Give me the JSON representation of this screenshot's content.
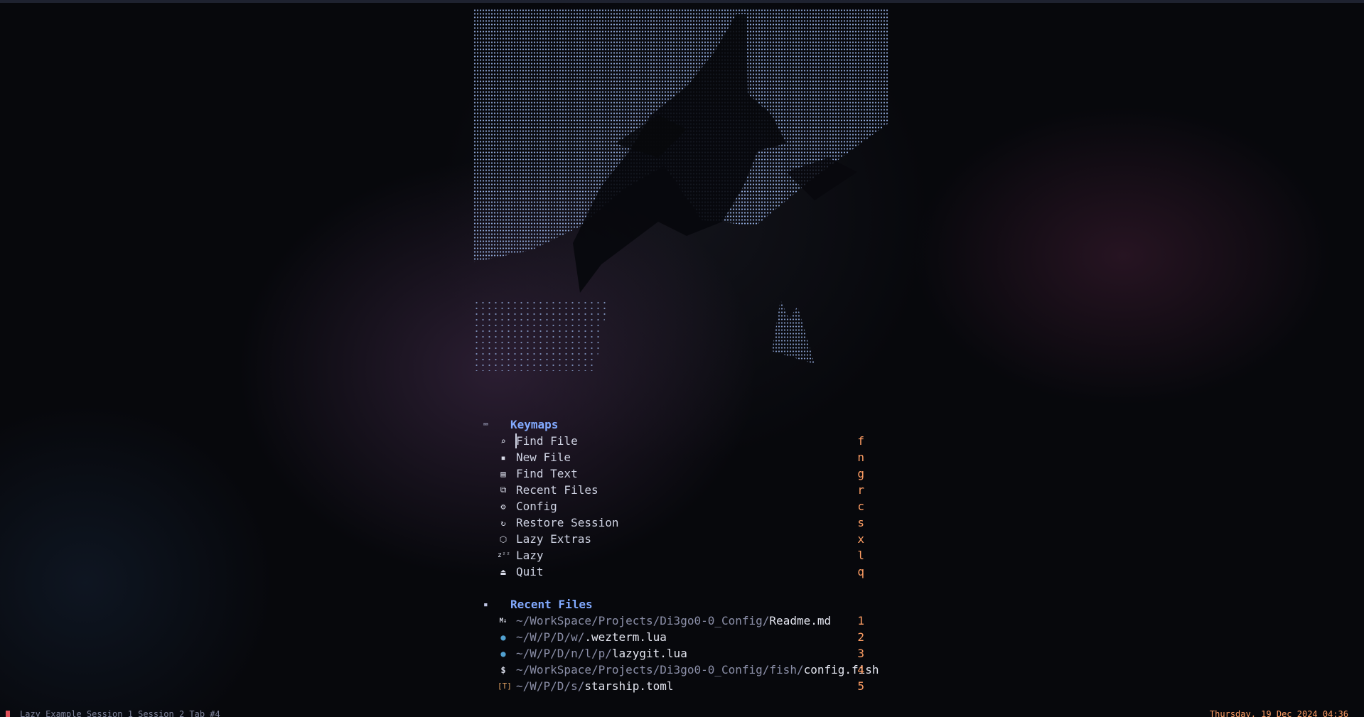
{
  "keymaps": {
    "title": "Keymaps",
    "items": [
      {
        "icon": "search-icon",
        "glyph": "⌕",
        "label": "Find File",
        "key": "f"
      },
      {
        "icon": "file-icon",
        "glyph": "▪",
        "label": "New File",
        "key": "n"
      },
      {
        "icon": "text-icon",
        "glyph": "▤",
        "label": "Find Text",
        "key": "g"
      },
      {
        "icon": "recent-icon",
        "glyph": "⧉",
        "label": "Recent Files",
        "key": "r"
      },
      {
        "icon": "gear-icon",
        "glyph": "⚙",
        "label": "Config",
        "key": "c"
      },
      {
        "icon": "restore-icon",
        "glyph": "↻",
        "label": "Restore Session",
        "key": "s"
      },
      {
        "icon": "box-icon",
        "glyph": "⬡",
        "label": "Lazy Extras",
        "key": "x"
      },
      {
        "icon": "sleep-icon",
        "glyph": "zᶻᶻ",
        "label": "Lazy",
        "key": "l"
      },
      {
        "icon": "quit-icon",
        "glyph": "⏏",
        "label": "Quit",
        "key": "q"
      }
    ]
  },
  "recent_files": {
    "title": "Recent Files",
    "items": [
      {
        "icon": "markdown-icon",
        "glyph": "M↓",
        "dir": "~/WorkSpace/Projects/Di3go0-0_Config/",
        "name": "Readme.md",
        "key": "1"
      },
      {
        "icon": "lua-icon",
        "glyph": "●",
        "dir": "~/W/P/D/w/",
        "name": ".wezterm.lua",
        "key": "2"
      },
      {
        "icon": "lua-icon",
        "glyph": "●",
        "dir": "~/W/P/D/n/l/p/",
        "name": "lazygit.lua",
        "key": "3"
      },
      {
        "icon": "shell-icon",
        "glyph": "$",
        "dir": "~/WorkSpace/Projects/Di3go0-0_Config/fish/",
        "name": "config.fish",
        "key": "4"
      },
      {
        "icon": "toml-icon",
        "glyph": "[T]",
        "dir": "~/W/P/D/s/",
        "name": "starship.toml",
        "key": "5"
      }
    ]
  },
  "statusbar": {
    "left": "Lazy  Example Session 1  Session 2  Tab #4",
    "right": "Thursday, 19 Dec 2024 04:36"
  },
  "colors": {
    "header": "#82aaff",
    "key": "#ff9e64",
    "art": "#8fa8d8"
  }
}
